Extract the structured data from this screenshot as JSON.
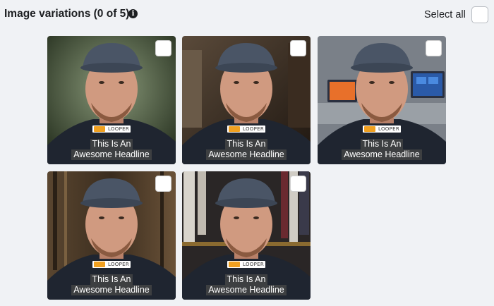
{
  "header": {
    "title": "Image variations (0 of 5)",
    "info_icon": "i",
    "select_all_label": "Select all"
  },
  "cards": [
    {
      "headline_line1": "This Is An",
      "headline_line2": "Awesome Headline",
      "logo_text": "LOOPER",
      "background": "dark-green studio",
      "bg_color": "#3c4a3a"
    },
    {
      "headline_line1": "This Is An",
      "headline_line2": "Awesome Headline",
      "logo_text": "LOOPER",
      "background": "dark brown room",
      "bg_color": "#3e2f25"
    },
    {
      "headline_line1": "This Is An",
      "headline_line2": "Awesome Headline",
      "logo_text": "LOOPER",
      "background": "office with monitors",
      "bg_color": "#5a6068"
    },
    {
      "headline_line1": "This Is An",
      "headline_line2": "Awesome Headline",
      "logo_text": "LOOPER",
      "background": "rustic wood wall",
      "bg_color": "#4a3a28"
    },
    {
      "headline_line1": "This Is An",
      "headline_line2": "Awesome Headline",
      "logo_text": "LOOPER",
      "background": "closet with clothes",
      "bg_color": "#2e2a2a"
    }
  ]
}
